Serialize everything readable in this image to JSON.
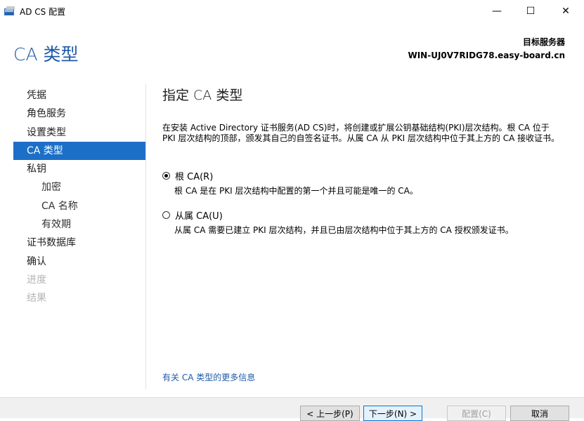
{
  "window": {
    "title": "AD CS 配置",
    "controls": {
      "minimize": "—",
      "maximize": "☐",
      "close": "✕"
    },
    "icon": "certificate-server-icon"
  },
  "header": {
    "page_title": "CA 类型",
    "target_label": "目标服务器",
    "target_server": "WIN-UJ0V7RIDG78.easy-board.cn"
  },
  "nav": {
    "items": [
      {
        "label": "凭据",
        "state": "normal"
      },
      {
        "label": "角色服务",
        "state": "normal"
      },
      {
        "label": "设置类型",
        "state": "normal"
      },
      {
        "label": "CA 类型",
        "state": "selected"
      },
      {
        "label": "私钥",
        "state": "normal"
      },
      {
        "label": "加密",
        "state": "sub"
      },
      {
        "label": "CA 名称",
        "state": "sub"
      },
      {
        "label": "有效期",
        "state": "sub"
      },
      {
        "label": "证书数据库",
        "state": "normal"
      },
      {
        "label": "确认",
        "state": "normal"
      },
      {
        "label": "进度",
        "state": "disabled"
      },
      {
        "label": "结果",
        "state": "disabled"
      }
    ]
  },
  "main": {
    "title": "指定 CA 类型",
    "description": "在安装 Active Directory 证书服务(AD CS)时，将创建或扩展公钥基础结构(PKI)层次结构。根 CA 位于 PKI 层次结构的顶部，颁发其自己的自签名证书。从属 CA 从 PKI 层次结构中位于其上方的 CA 接收证书。",
    "options": [
      {
        "label": "根 CA(R)",
        "checked": true,
        "description": "根 CA 是在 PKI 层次结构中配置的第一个并且可能是唯一的 CA。"
      },
      {
        "label": "从属 CA(U)",
        "checked": false,
        "description": "从属 CA 需要已建立 PKI 层次结构，并且已由层次结构中位于其上方的 CA 授权颁发证书。"
      }
    ],
    "more_info_link": "有关 CA 类型的更多信息"
  },
  "footer": {
    "prev": "< 上一步(P)",
    "next": "下一步(N) >",
    "configure": "配置(C)",
    "cancel": "取消"
  },
  "colors": {
    "accent": "#1c6fc6",
    "heading": "#1e5aa8",
    "disabled": "#b5b5b5"
  }
}
